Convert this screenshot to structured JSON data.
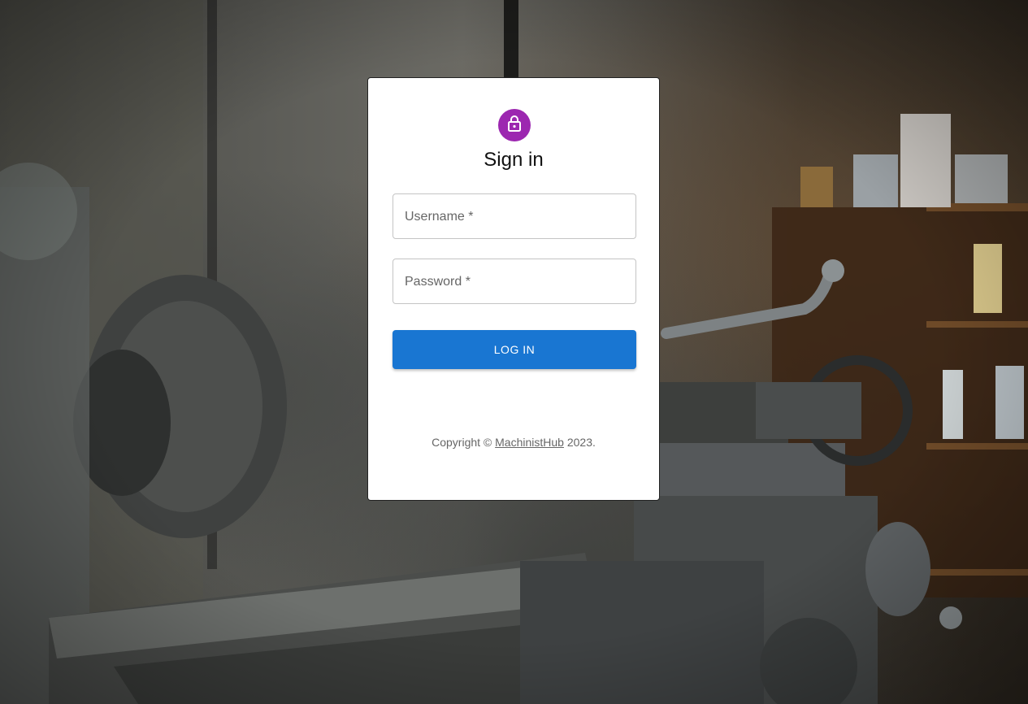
{
  "form": {
    "title": "Sign in",
    "username_label": "Username *",
    "password_label": "Password *",
    "submit_label": "LOG IN",
    "lock_icon": "lock-icon"
  },
  "footer": {
    "prefix": "Copyright © ",
    "link_text": "MachinistHub",
    "suffix": " 2023."
  },
  "colors": {
    "avatar": "#9c27b0",
    "primary": "#1976d2"
  }
}
